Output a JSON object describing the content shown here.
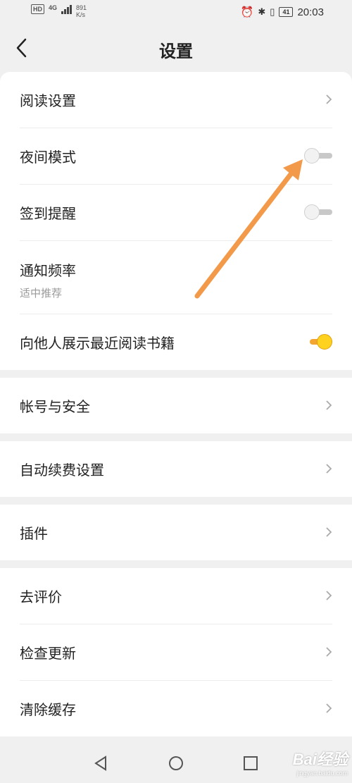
{
  "status_bar": {
    "hd": "HD",
    "network": "4G",
    "speed_value": "891",
    "speed_unit": "K/s",
    "battery": "41",
    "time": "20:03"
  },
  "header": {
    "title": "设置",
    "back_icon": "chevron-left-icon"
  },
  "groups": [
    {
      "items": [
        {
          "label": "阅读设置",
          "control": "chevron"
        },
        {
          "label": "夜间模式",
          "control": "toggle",
          "on": false
        },
        {
          "label": "签到提醒",
          "control": "toggle",
          "on": false
        },
        {
          "label": "通知频率",
          "sublabel": "适中推荐",
          "control": "none"
        },
        {
          "label": "向他人展示最近阅读书籍",
          "control": "toggle",
          "on": true
        }
      ]
    },
    {
      "items": [
        {
          "label": "帐号与安全",
          "control": "chevron"
        }
      ]
    },
    {
      "items": [
        {
          "label": "自动续费设置",
          "control": "chevron"
        }
      ]
    },
    {
      "items": [
        {
          "label": "插件",
          "control": "chevron"
        }
      ]
    },
    {
      "items": [
        {
          "label": "去评价",
          "control": "chevron"
        },
        {
          "label": "检查更新",
          "control": "chevron"
        },
        {
          "label": "清除缓存",
          "control": "chevron"
        }
      ]
    }
  ],
  "colors": {
    "toggle_on_knob": "#ffd21f",
    "toggle_on_track": "#f2a531",
    "annotation_arrow": "#f39a4a"
  },
  "nav_bar": {
    "back": "triangle-back-icon",
    "home": "circle-home-icon",
    "recent": "square-recent-icon"
  },
  "watermark": {
    "text": "Bai经验",
    "sub": "jingyan.baidu.com"
  }
}
